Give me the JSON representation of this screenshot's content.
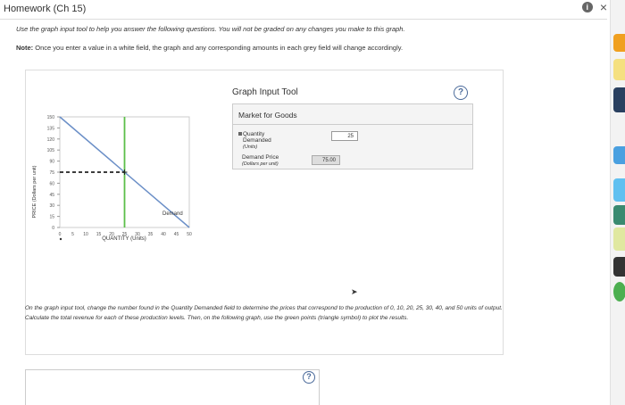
{
  "header": {
    "title": "Homework (Ch 15)",
    "info_icon": "info-icon",
    "close_icon": "close-icon",
    "close_glyph": "×",
    "info_glyph": "i"
  },
  "instructions": "Use the graph input tool to help you answer the following questions. You will not be graded on any changes you make to this graph.",
  "note": {
    "label": "Note:",
    "text": "Once you enter a value in a white field, the graph and any corresponding amounts in each grey field will change accordingly."
  },
  "graph_input_tool": {
    "title": "Graph Input Tool",
    "help": "?",
    "market": "Market for Goods",
    "qty_label": "Quantity",
    "qty_label2": "Demanded",
    "qty_unit": "(Units)",
    "qty_value": "25",
    "price_label": "Demand Price",
    "price_unit": "(Dollars per unit)",
    "price_value": "75.00"
  },
  "chart_data": {
    "type": "line",
    "ylabel": "PRICE (Dollars per unit)",
    "xlabel": "QUANTITY (Units)",
    "xlim": [
      0,
      50
    ],
    "ylim": [
      0,
      150
    ],
    "xticks": [
      "0",
      "5",
      "10",
      "15",
      "20",
      "25",
      "30",
      "35",
      "40",
      "45",
      "50"
    ],
    "yticks": [
      "0",
      "15",
      "30",
      "45",
      "60",
      "75",
      "90",
      "105",
      "120",
      "135",
      "150"
    ],
    "series": [
      {
        "name": "Demand",
        "x": [
          0,
          50
        ],
        "y": [
          150,
          0
        ],
        "color": "#6b8fc7"
      }
    ],
    "vertical_line": {
      "x": 25,
      "color": "#5cbf4a"
    },
    "dashed_line": {
      "y": 75,
      "x_to": 25,
      "color": "#222"
    },
    "point": {
      "x": 25,
      "y": 75
    }
  },
  "question": "On the graph input tool, change the number found in the Quantity Demanded field to determine the prices that correspond to the production of 0, 10, 20, 25, 30, 40, and 50 units of output. Calculate the total revenue for each of these production levels. Then, on the following graph, use the green points (triangle symbol) to plot the results.",
  "second_help": "?",
  "colors": {
    "demand": "#6b8fc7",
    "vertical": "#5cbf4a",
    "help_blue": "#4a6a9a"
  }
}
